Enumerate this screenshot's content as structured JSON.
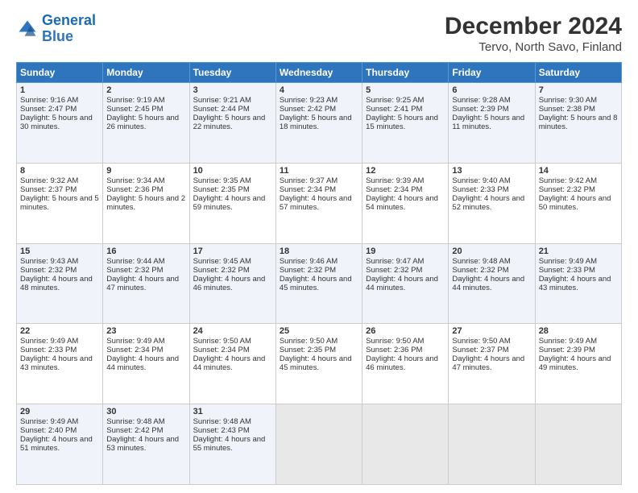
{
  "logo": {
    "line1": "General",
    "line2": "Blue"
  },
  "title": "December 2024",
  "subtitle": "Tervo, North Savo, Finland",
  "days_header": [
    "Sunday",
    "Monday",
    "Tuesday",
    "Wednesday",
    "Thursday",
    "Friday",
    "Saturday"
  ],
  "weeks": [
    [
      {
        "day": "1",
        "sunrise": "Sunrise: 9:16 AM",
        "sunset": "Sunset: 2:47 PM",
        "daylight": "Daylight: 5 hours and 30 minutes."
      },
      {
        "day": "2",
        "sunrise": "Sunrise: 9:19 AM",
        "sunset": "Sunset: 2:45 PM",
        "daylight": "Daylight: 5 hours and 26 minutes."
      },
      {
        "day": "3",
        "sunrise": "Sunrise: 9:21 AM",
        "sunset": "Sunset: 2:44 PM",
        "daylight": "Daylight: 5 hours and 22 minutes."
      },
      {
        "day": "4",
        "sunrise": "Sunrise: 9:23 AM",
        "sunset": "Sunset: 2:42 PM",
        "daylight": "Daylight: 5 hours and 18 minutes."
      },
      {
        "day": "5",
        "sunrise": "Sunrise: 9:25 AM",
        "sunset": "Sunset: 2:41 PM",
        "daylight": "Daylight: 5 hours and 15 minutes."
      },
      {
        "day": "6",
        "sunrise": "Sunrise: 9:28 AM",
        "sunset": "Sunset: 2:39 PM",
        "daylight": "Daylight: 5 hours and 11 minutes."
      },
      {
        "day": "7",
        "sunrise": "Sunrise: 9:30 AM",
        "sunset": "Sunset: 2:38 PM",
        "daylight": "Daylight: 5 hours and 8 minutes."
      }
    ],
    [
      {
        "day": "8",
        "sunrise": "Sunrise: 9:32 AM",
        "sunset": "Sunset: 2:37 PM",
        "daylight": "Daylight: 5 hours and 5 minutes."
      },
      {
        "day": "9",
        "sunrise": "Sunrise: 9:34 AM",
        "sunset": "Sunset: 2:36 PM",
        "daylight": "Daylight: 5 hours and 2 minutes."
      },
      {
        "day": "10",
        "sunrise": "Sunrise: 9:35 AM",
        "sunset": "Sunset: 2:35 PM",
        "daylight": "Daylight: 4 hours and 59 minutes."
      },
      {
        "day": "11",
        "sunrise": "Sunrise: 9:37 AM",
        "sunset": "Sunset: 2:34 PM",
        "daylight": "Daylight: 4 hours and 57 minutes."
      },
      {
        "day": "12",
        "sunrise": "Sunrise: 9:39 AM",
        "sunset": "Sunset: 2:34 PM",
        "daylight": "Daylight: 4 hours and 54 minutes."
      },
      {
        "day": "13",
        "sunrise": "Sunrise: 9:40 AM",
        "sunset": "Sunset: 2:33 PM",
        "daylight": "Daylight: 4 hours and 52 minutes."
      },
      {
        "day": "14",
        "sunrise": "Sunrise: 9:42 AM",
        "sunset": "Sunset: 2:32 PM",
        "daylight": "Daylight: 4 hours and 50 minutes."
      }
    ],
    [
      {
        "day": "15",
        "sunrise": "Sunrise: 9:43 AM",
        "sunset": "Sunset: 2:32 PM",
        "daylight": "Daylight: 4 hours and 48 minutes."
      },
      {
        "day": "16",
        "sunrise": "Sunrise: 9:44 AM",
        "sunset": "Sunset: 2:32 PM",
        "daylight": "Daylight: 4 hours and 47 minutes."
      },
      {
        "day": "17",
        "sunrise": "Sunrise: 9:45 AM",
        "sunset": "Sunset: 2:32 PM",
        "daylight": "Daylight: 4 hours and 46 minutes."
      },
      {
        "day": "18",
        "sunrise": "Sunrise: 9:46 AM",
        "sunset": "Sunset: 2:32 PM",
        "daylight": "Daylight: 4 hours and 45 minutes."
      },
      {
        "day": "19",
        "sunrise": "Sunrise: 9:47 AM",
        "sunset": "Sunset: 2:32 PM",
        "daylight": "Daylight: 4 hours and 44 minutes."
      },
      {
        "day": "20",
        "sunrise": "Sunrise: 9:48 AM",
        "sunset": "Sunset: 2:32 PM",
        "daylight": "Daylight: 4 hours and 44 minutes."
      },
      {
        "day": "21",
        "sunrise": "Sunrise: 9:49 AM",
        "sunset": "Sunset: 2:33 PM",
        "daylight": "Daylight: 4 hours and 43 minutes."
      }
    ],
    [
      {
        "day": "22",
        "sunrise": "Sunrise: 9:49 AM",
        "sunset": "Sunset: 2:33 PM",
        "daylight": "Daylight: 4 hours and 43 minutes."
      },
      {
        "day": "23",
        "sunrise": "Sunrise: 9:49 AM",
        "sunset": "Sunset: 2:34 PM",
        "daylight": "Daylight: 4 hours and 44 minutes."
      },
      {
        "day": "24",
        "sunrise": "Sunrise: 9:50 AM",
        "sunset": "Sunset: 2:34 PM",
        "daylight": "Daylight: 4 hours and 44 minutes."
      },
      {
        "day": "25",
        "sunrise": "Sunrise: 9:50 AM",
        "sunset": "Sunset: 2:35 PM",
        "daylight": "Daylight: 4 hours and 45 minutes."
      },
      {
        "day": "26",
        "sunrise": "Sunrise: 9:50 AM",
        "sunset": "Sunset: 2:36 PM",
        "daylight": "Daylight: 4 hours and 46 minutes."
      },
      {
        "day": "27",
        "sunrise": "Sunrise: 9:50 AM",
        "sunset": "Sunset: 2:37 PM",
        "daylight": "Daylight: 4 hours and 47 minutes."
      },
      {
        "day": "28",
        "sunrise": "Sunrise: 9:49 AM",
        "sunset": "Sunset: 2:39 PM",
        "daylight": "Daylight: 4 hours and 49 minutes."
      }
    ],
    [
      {
        "day": "29",
        "sunrise": "Sunrise: 9:49 AM",
        "sunset": "Sunset: 2:40 PM",
        "daylight": "Daylight: 4 hours and 51 minutes."
      },
      {
        "day": "30",
        "sunrise": "Sunrise: 9:48 AM",
        "sunset": "Sunset: 2:42 PM",
        "daylight": "Daylight: 4 hours and 53 minutes."
      },
      {
        "day": "31",
        "sunrise": "Sunrise: 9:48 AM",
        "sunset": "Sunset: 2:43 PM",
        "daylight": "Daylight: 4 hours and 55 minutes."
      },
      null,
      null,
      null,
      null
    ]
  ]
}
